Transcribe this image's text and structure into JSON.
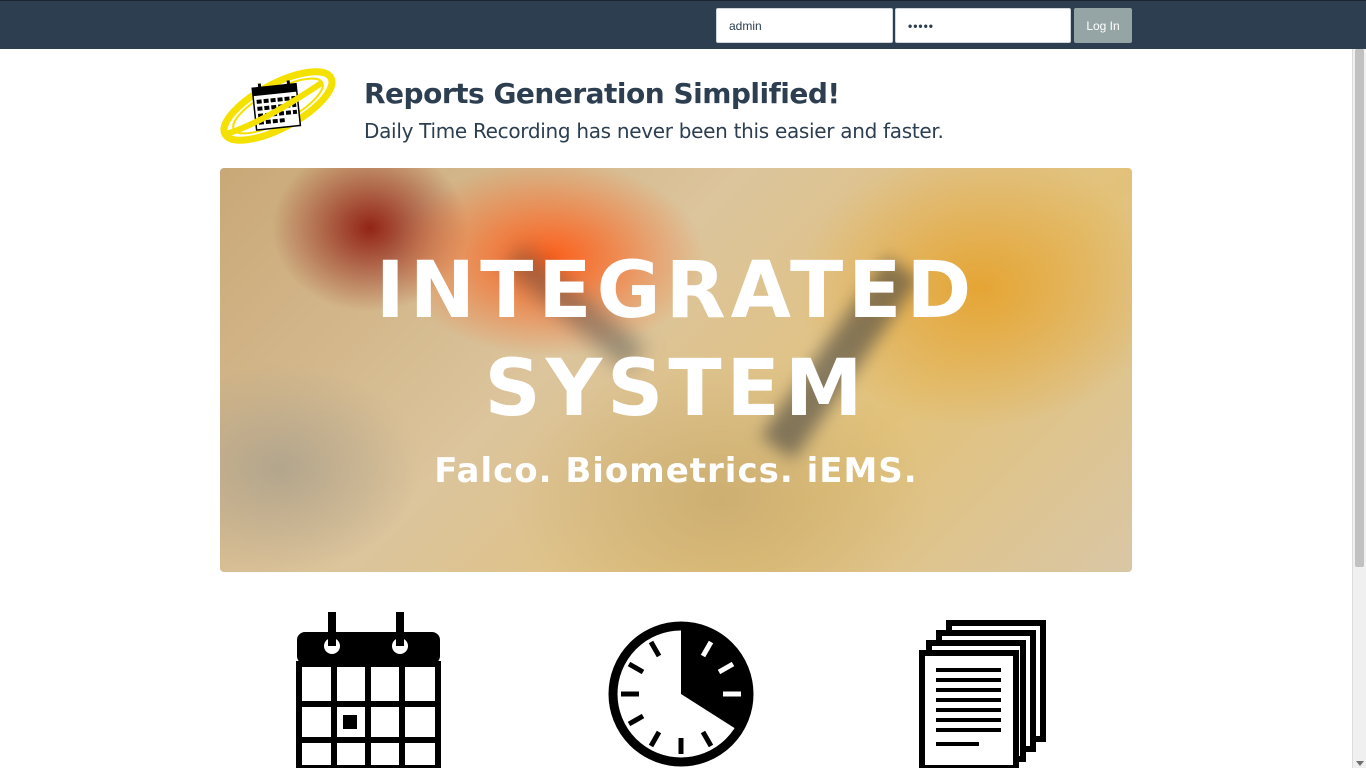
{
  "login": {
    "username_value": "admin",
    "password_value": "•••••",
    "button_label": "Log In"
  },
  "hero": {
    "title": "Reports Generation Simplified!",
    "subtitle": "Daily Time Recording has never been this easier and faster."
  },
  "banner": {
    "line1": "INTEGRATED",
    "line2": "SYSTEM",
    "tagline": "Falco. Biometrics. iEMS."
  },
  "features": [
    {
      "icon": "calendar-icon"
    },
    {
      "icon": "clock-icon"
    },
    {
      "icon": "documents-icon"
    }
  ],
  "colors": {
    "navbar": "#2c3e50",
    "heading_text": "#2c3e50",
    "login_button": "#95a5a6",
    "logo_ring": "#f5e100"
  }
}
